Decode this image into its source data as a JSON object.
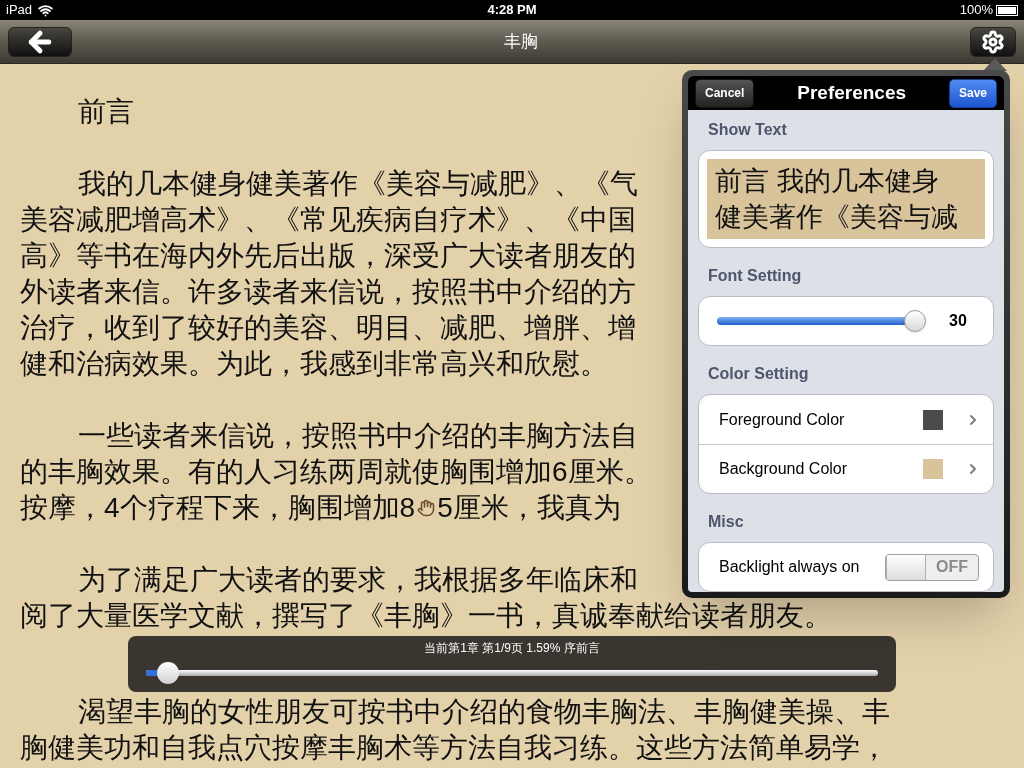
{
  "status_bar": {
    "carrier": "iPad",
    "time": "4:28 PM",
    "battery": "100%"
  },
  "nav_bar": {
    "title": "丰胸"
  },
  "book": {
    "paragraphs": [
      {
        "lines": [
          [
            "前言"
          ]
        ]
      },
      {
        "lines": [
          [
            "我的几本健身健美著作《美容与减肥》、《气"
          ],
          [
            "美容减肥增高术》、《常见疾病自疗术》、《中国"
          ],
          [
            "高》等书在海内外先后出版，深受广大读者朋友的"
          ],
          [
            "外读者来信。许多读者来信说，按照书中介绍的方"
          ],
          [
            "治疗，收到了较好的美容、明目、减肥、增胖、增"
          ],
          [
            "健和治病效果。为此，我感到非常高兴和欣慰。"
          ]
        ]
      },
      {
        "lines": [
          [
            "一些读者来信说，按照书中介绍的丰胸方法自"
          ],
          [
            "的丰胸效果。有的人习练两周就使胸围增加6厘米。"
          ],
          [
            "按摩，4个疗程下来，胸围增加8",
            "5厘米，我真为"
          ]
        ]
      },
      {
        "lines": [
          [
            "为了满足广大读者的要求，我根据多年临床和"
          ],
          [
            "阅了大量医学文献，撰写了《丰胸》一书，真诚奉献给读者朋友。"
          ]
        ]
      },
      {
        "lines": [
          [
            "渴望丰胸的女性朋友可按书中介绍的食物丰胸法、丰胸健美操、丰"
          ],
          [
            "胸健美功和自我点穴按摩丰胸术等方法自我习练。这些方法简单易学，"
          ]
        ]
      }
    ]
  },
  "progress": {
    "text": "当前第1章 第1/9页 1.59% 序前言",
    "level": 0.03
  },
  "preferences": {
    "title": "Preferences",
    "cancel": "Cancel",
    "save": "Save",
    "sections": [
      {
        "kind": "preview",
        "header": "Show Text",
        "lines": [
          "前言 我的几本健身",
          "健美著作《美容与减"
        ]
      },
      {
        "kind": "slider",
        "header": "Font Setting",
        "level": 0.95,
        "reading": "30"
      },
      {
        "kind": "colors",
        "header": "Color Setting",
        "rows": [
          {
            "label": "Foreground Color",
            "color": "#4b4b4d"
          },
          {
            "label": "Background Color",
            "color": "#d9c39b"
          }
        ]
      },
      {
        "kind": "toggle",
        "header": "Misc",
        "label": "Backlight always on",
        "on": false,
        "off_text": "OFF"
      }
    ]
  }
}
